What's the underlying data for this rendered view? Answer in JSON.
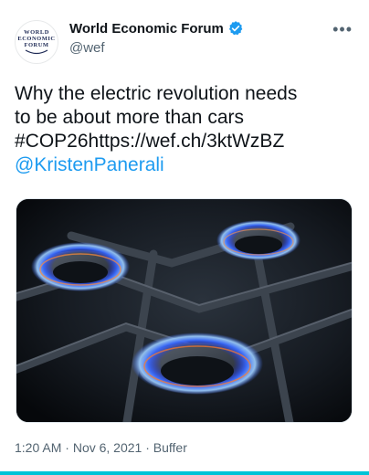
{
  "author": {
    "name": "World Economic Forum",
    "handle": "@wef",
    "avatar_text": [
      "WORLD",
      "ECONOMIC",
      "FORUM"
    ],
    "verified_icon": "verified-badge-icon"
  },
  "more_icon": "more-options-icon",
  "tweet": {
    "line1": "Why the electric revolution needs",
    "line2": "to be about more than cars",
    "line3": "#COP26https://wef.ch/3ktWzBZ",
    "mention": "@KristenPanerali"
  },
  "media": {
    "subject": "gas stove burners with blue flames"
  },
  "meta": {
    "time": "1:20 AM",
    "date": "Nov 6, 2021",
    "source": "Buffer",
    "separator": " · "
  },
  "colors": {
    "accent": "#1d9bf0",
    "secondary_text": "#536471",
    "bottom_bar": "#00c3d7"
  }
}
